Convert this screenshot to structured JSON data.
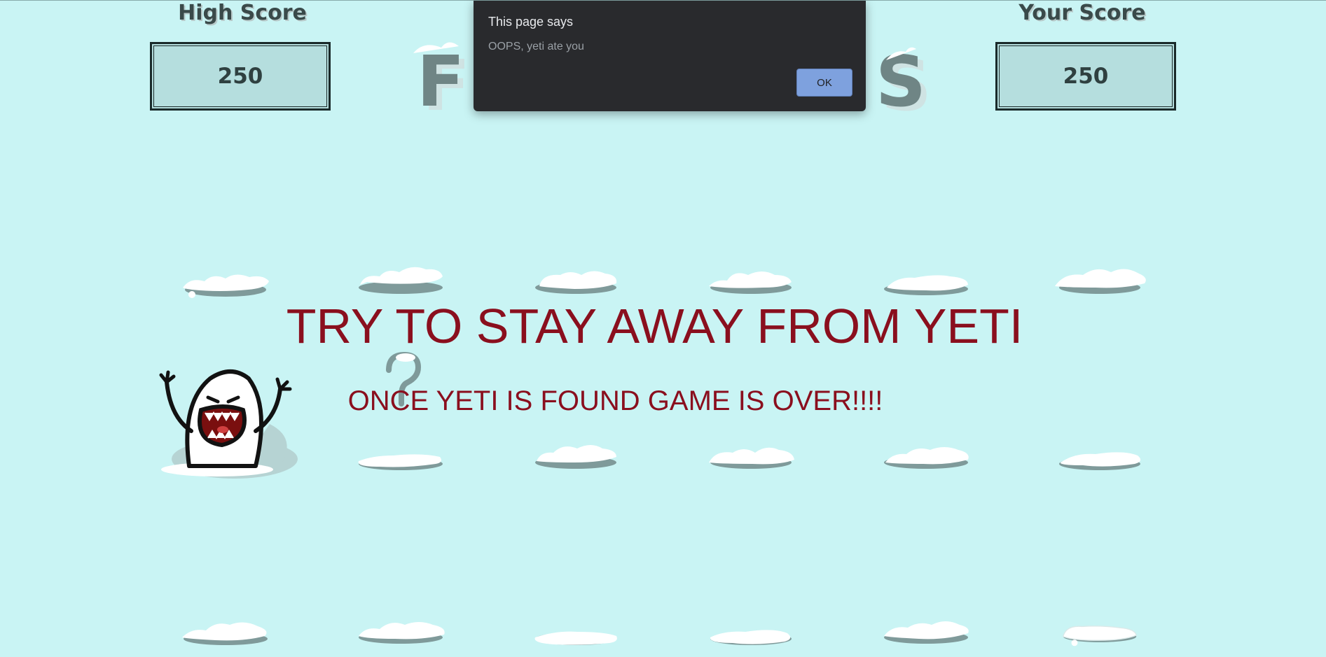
{
  "scores": {
    "high_label": "High Score",
    "high_value": "250",
    "your_label": "Your Score",
    "your_value": "250"
  },
  "headlines": {
    "main": "TRY TO STAY AWAY FROM YETI",
    "sub": "ONCE YETI IS FOUND GAME IS OVER!!!!"
  },
  "dialog": {
    "title": "This page says",
    "message": "OOPS, yeti ate you",
    "ok_label": "OK"
  },
  "logo_fragments": {
    "left": "F",
    "right": "S"
  },
  "colors": {
    "background": "#c9f4f4",
    "headline": "#8a0f1e",
    "score_box": "#b5dede",
    "dialog_bg": "#292a2d",
    "ok_button": "#7ea1de"
  }
}
